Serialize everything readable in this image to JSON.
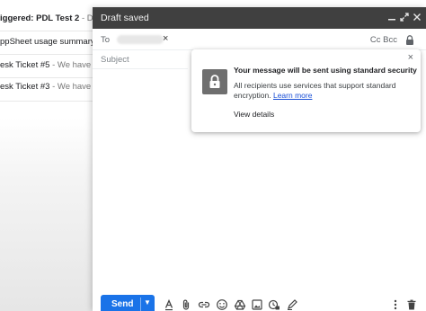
{
  "inbox": {
    "rows": [
      {
        "sender": "iggered: PDL Test 2",
        "snippet": " - Data",
        "bold": true
      },
      {
        "sender": "ppSheet usage summary a",
        "snippet": "",
        "bold": false
      },
      {
        "sender": "esk Ticket #5",
        "snippet": " - We have re",
        "bold": false
      },
      {
        "sender": "esk Ticket #3",
        "snippet": " - We have re",
        "bold": false
      }
    ]
  },
  "compose": {
    "title": "Draft saved",
    "to_label": "To",
    "chip_remove": "×",
    "cc_bcc": "Cc Bcc",
    "subject_placeholder": "Subject"
  },
  "popup": {
    "title": "Your message will be sent using standard security",
    "description": "All recipients use services that support standard encryption.",
    "learn_more": "Learn more",
    "view_details": "View details",
    "close": "×"
  },
  "toolbar": {
    "send_label": "Send",
    "icons": [
      "text-format-icon",
      "attach-icon",
      "link-icon",
      "emoji-icon",
      "drive-icon",
      "photo-icon",
      "confidential-icon",
      "signature-icon",
      "more-options-icon",
      "discard-icon"
    ]
  },
  "colors": {
    "header_bg": "#404040",
    "send_blue": "#1a73e8",
    "link_blue": "#1a4fd6"
  }
}
